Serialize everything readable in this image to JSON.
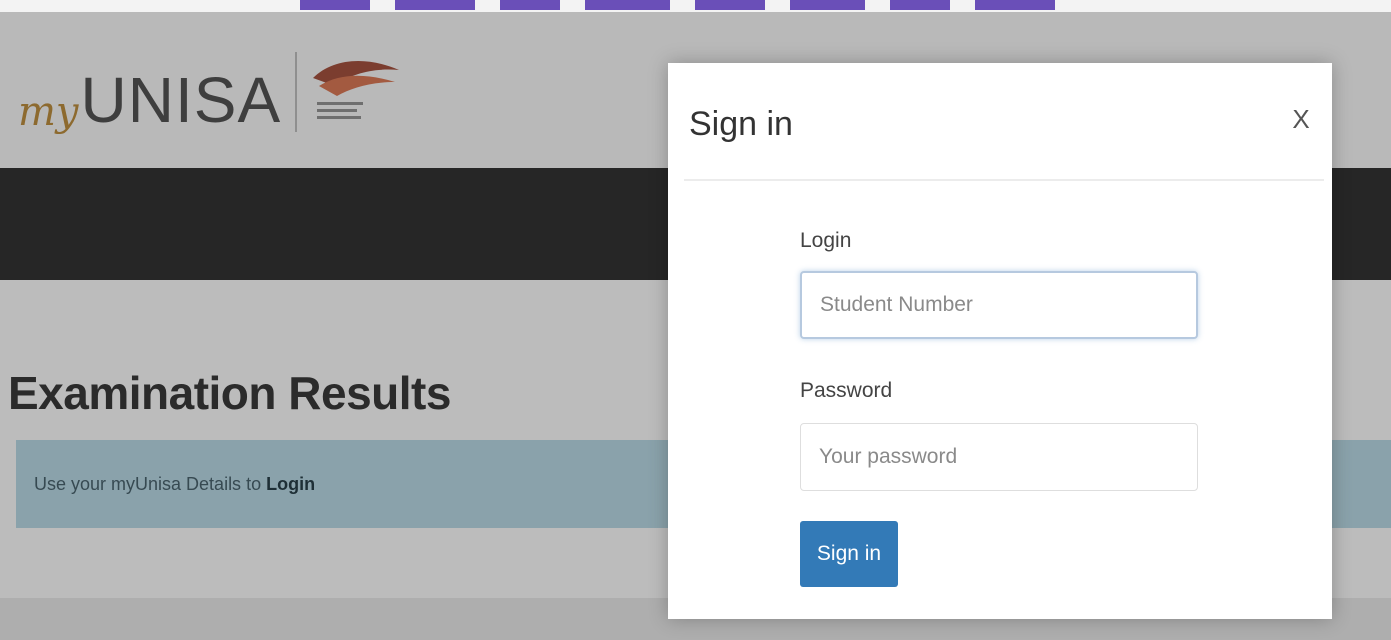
{
  "site": {
    "logo_prefix": "my",
    "logo_name": "UNISA",
    "page_title": "Examination Results",
    "info_prefix": "Use your myUnisa Details to ",
    "info_link": "Login"
  },
  "modal": {
    "title": "Sign in",
    "close_label": "X",
    "login_label": "Login",
    "login_placeholder": "Student Number",
    "password_label": "Password",
    "password_placeholder": "Your password",
    "submit_label": "Sign in"
  },
  "colors": {
    "primary_button": "#337ab7",
    "nav_dark": "#262626",
    "info_strip": "#8aa2ab",
    "banner_purple": "#6a4fb8"
  },
  "icons": {
    "logo_emblem": "unisa-emblem-icon"
  }
}
